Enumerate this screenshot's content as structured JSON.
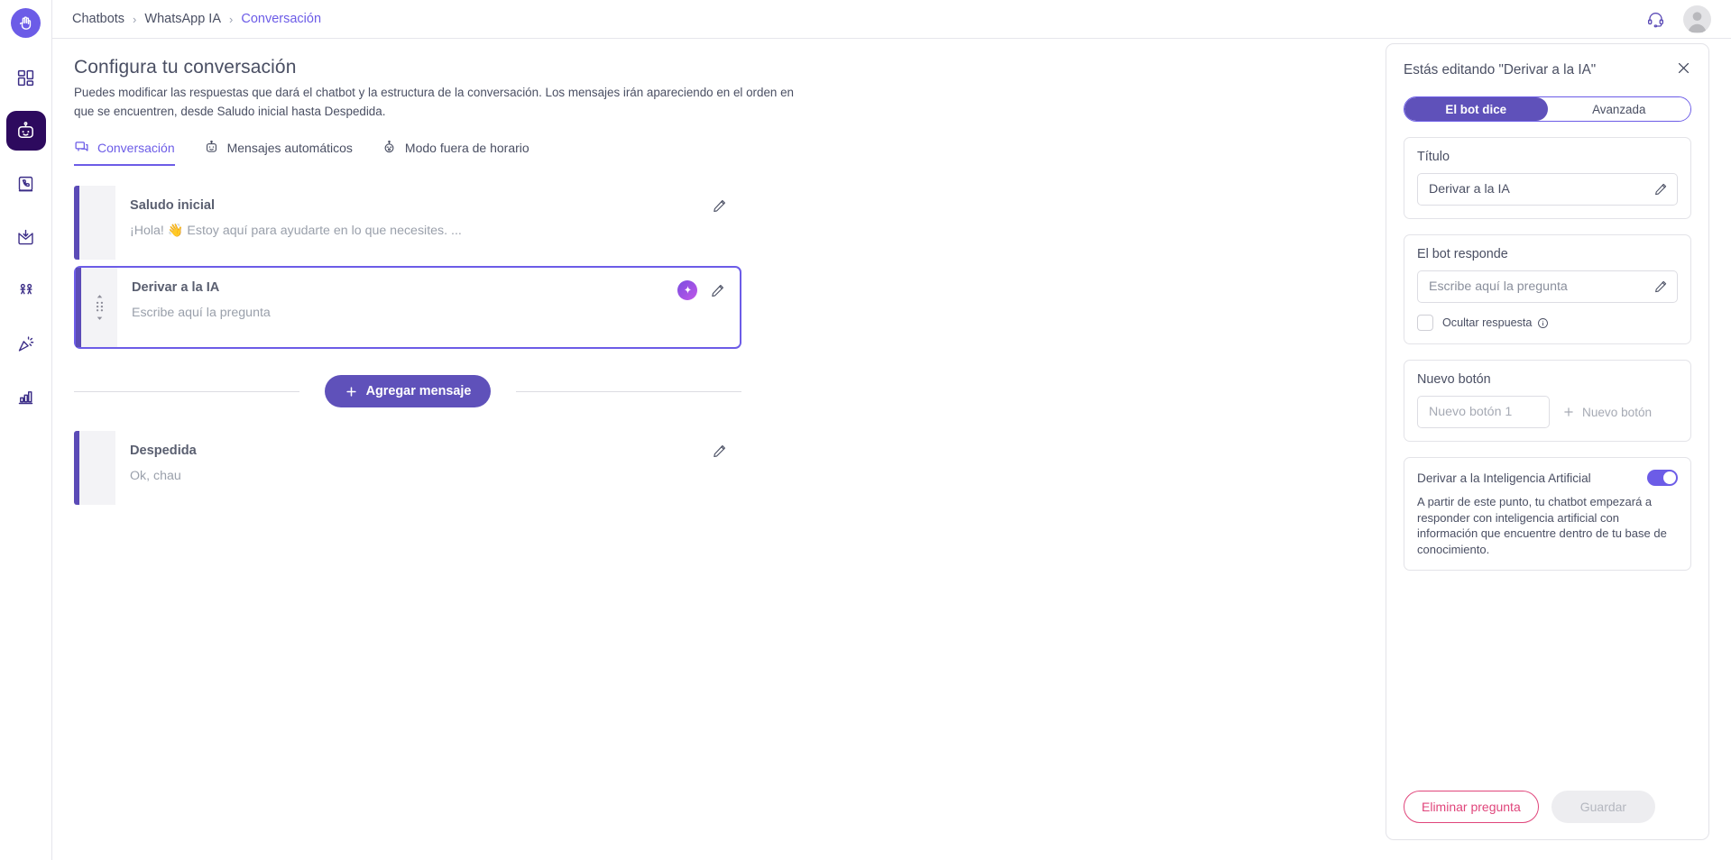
{
  "brand": {
    "logo_icon": "hand-palm-icon",
    "accent_purple": "#6c5ce7",
    "accent_purple_dark": "#5f51ba",
    "rail_active_bg": "#2d0a5e",
    "danger_pink": "#e0457b"
  },
  "rail": {
    "items": [
      {
        "icon": "dashboard-grid-icon",
        "name": "sidebar-item-dashboard",
        "active": false
      },
      {
        "icon": "chatbot-robot-icon",
        "name": "sidebar-item-chatbots",
        "active": true
      },
      {
        "icon": "phone-book-icon",
        "name": "sidebar-item-contacts",
        "active": false
      },
      {
        "icon": "inbox-download-icon",
        "name": "sidebar-item-inbox",
        "active": false
      },
      {
        "icon": "users-group-icon",
        "name": "sidebar-item-teams",
        "active": false
      },
      {
        "icon": "megaphone-campaign-icon",
        "name": "sidebar-item-campaigns",
        "active": false
      },
      {
        "icon": "bar-chart-icon",
        "name": "sidebar-item-reports",
        "active": false
      }
    ]
  },
  "topbar": {
    "breadcrumb": [
      {
        "label": "Chatbots",
        "current": false
      },
      {
        "label": "WhatsApp IA",
        "current": false
      },
      {
        "label": "Conversación",
        "current": true
      }
    ],
    "separator": "›",
    "support_icon": "headset-support-icon",
    "avatar_icon": "user-avatar-icon"
  },
  "page": {
    "title": "Configura tu conversación",
    "subtitle": "Puedes modificar las respuestas que dará el chatbot y la estructura de la conversación. Los mensajes irán apareciendo en el orden en que se encuentren, desde Saludo inicial hasta Despedida."
  },
  "tabs": [
    {
      "label": "Conversación",
      "icon": "chat-bubbles-icon",
      "active": true
    },
    {
      "label": "Mensajes automáticos",
      "icon": "robot-face-icon",
      "active": false
    },
    {
      "label": "Modo fuera de horario",
      "icon": "robot-sleep-icon",
      "active": false
    }
  ],
  "messages": [
    {
      "title": "Saludo inicial",
      "preview": "¡Hola! 👋 Estoy aquí para ayudarte en lo que necesites. ...",
      "selected": false,
      "draggable": false,
      "has_ai_badge": false,
      "edit_icon": "pencil-edit-icon"
    },
    {
      "title": "Derivar a la IA",
      "preview": "Escribe aquí la pregunta",
      "selected": true,
      "draggable": true,
      "has_ai_badge": true,
      "ai_icon": "ai-sparkle-icon",
      "drag_icon": "drag-handle-icon",
      "edit_icon": "pencil-edit-icon"
    }
  ],
  "add_message": {
    "label": "Agregar mensaje",
    "icon": "plus-icon"
  },
  "farewell": {
    "title": "Despedida",
    "preview": "Ok, chau",
    "edit_icon": "pencil-edit-icon"
  },
  "side_panel": {
    "title": "Estás editando \"Derivar a la IA\"",
    "close_icon": "close-x-icon",
    "segments": [
      {
        "label": "El bot dice",
        "active": true
      },
      {
        "label": "Avanzada",
        "active": false
      }
    ],
    "titulo": {
      "label": "Título",
      "value": "Derivar a la IA",
      "edit_icon": "pencil-edit-icon"
    },
    "responde": {
      "label": "El bot responde",
      "placeholder": "Escribe aquí la pregunta",
      "edit_icon": "pencil-edit-icon",
      "checkbox_label": "Ocultar respuesta",
      "checkbox_checked": false,
      "info_icon": "info-circle-icon"
    },
    "nuevo_boton": {
      "label": "Nuevo botón",
      "input_placeholder": "Nuevo botón 1",
      "add_label": "Nuevo botón",
      "add_icon": "plus-icon"
    },
    "derivar_ia": {
      "label": "Derivar a la Inteligencia Artificial",
      "enabled": true,
      "description": "A partir de este punto, tu chatbot empezará a responder con inteligencia artificial con información que encuentre dentro de tu base de conocimiento."
    },
    "footer": {
      "delete_label": "Eliminar pregunta",
      "save_label": "Guardar",
      "save_disabled": true
    }
  }
}
